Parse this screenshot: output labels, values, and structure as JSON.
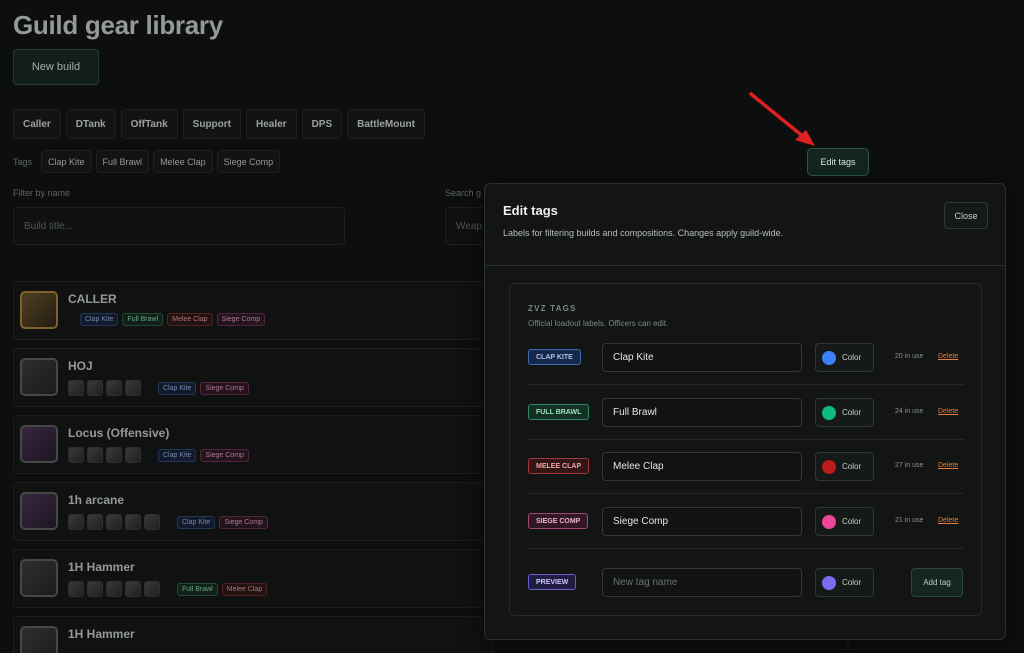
{
  "page": {
    "title": "Guild gear library",
    "new_build_label": "New build"
  },
  "roles": [
    "Caller",
    "DTank",
    "OffTank",
    "Support",
    "Healer",
    "DPS",
    "BattleMount"
  ],
  "tags_filter": {
    "label": "Tags",
    "items": [
      "Clap Kite",
      "Full Brawl",
      "Melee Clap",
      "Siege Comp"
    ],
    "edit_label": "Edit tags"
  },
  "filters": {
    "name_label": "Filter by name",
    "name_placeholder": "Build title...",
    "search_label": "Search g",
    "search_placeholder": "Weap"
  },
  "builds": [
    {
      "title": "CALLER",
      "tags": [
        "Clap Kite",
        "Full Brawl",
        "Melee Clap",
        "Siege Comp"
      ]
    },
    {
      "title": "HOJ",
      "tags": [
        "Clap Kite",
        "Siege Comp"
      ]
    },
    {
      "title": "Locus (Offensive)",
      "tags": [
        "Clap Kite",
        "Siege Comp"
      ]
    },
    {
      "title": "1h arcane",
      "tags": [
        "Clap Kite",
        "Siege Comp"
      ]
    },
    {
      "title": "1H Hammer",
      "tags": [
        "Full Brawl",
        "Melee Clap"
      ]
    },
    {
      "title": "1H Hammer",
      "tags": []
    }
  ],
  "modal": {
    "title": "Edit tags",
    "subtitle": "Labels for filtering builds and compositions. Changes apply guild-wide.",
    "close_label": "Close",
    "section_title": "ZVZ TAGS",
    "section_subtitle": "Official loadout labels. Officers can edit.",
    "color_label": "Color",
    "delete_label": "Delete",
    "tags": [
      {
        "pill": "CLAP KITE",
        "name": "Clap Kite",
        "color": "#3b82f6",
        "usage": "20 in use"
      },
      {
        "pill": "FULL BRAWL",
        "name": "Full Brawl",
        "color": "#10b981",
        "usage": "24 in use"
      },
      {
        "pill": "MELEE CLAP",
        "name": "Melee Clap",
        "color": "#b91c1c",
        "usage": "27 in use"
      },
      {
        "pill": "SIEGE COMP",
        "name": "Siege Comp",
        "color": "#ec4899",
        "usage": "21 in use"
      }
    ],
    "new_tag": {
      "pill": "PREVIEW",
      "placeholder": "New tag name",
      "color": "#7c6cf0",
      "add_label": "Add tag"
    }
  },
  "more_hint": "⋮"
}
